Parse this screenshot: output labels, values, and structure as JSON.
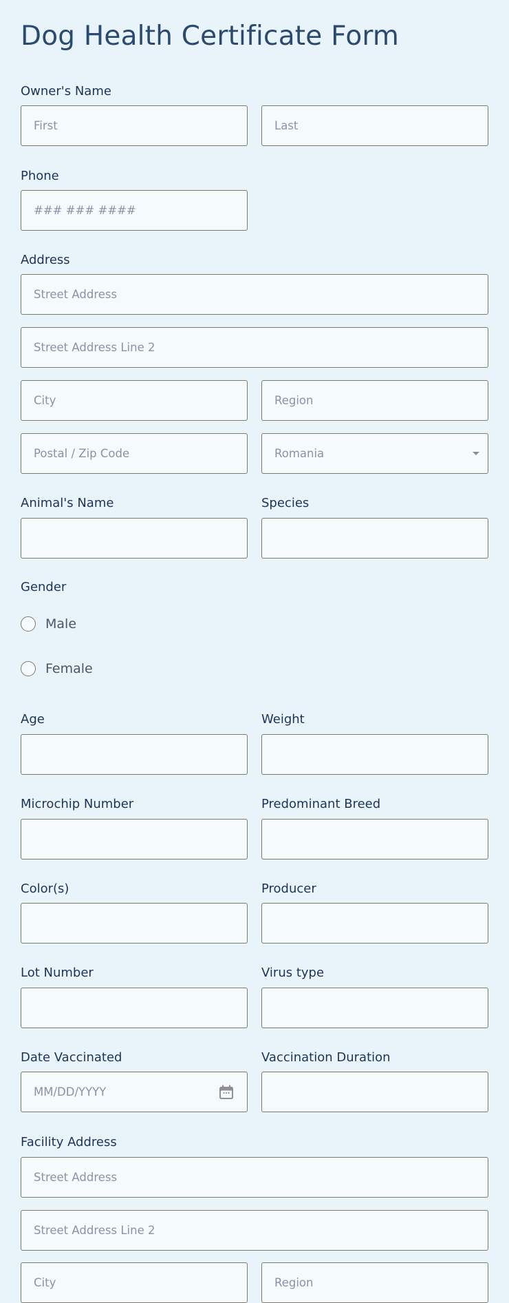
{
  "form": {
    "title": "Dog Health Certificate Form",
    "owner": {
      "label": "Owner's Name",
      "first_placeholder": "First",
      "last_placeholder": "Last"
    },
    "phone": {
      "label": "Phone",
      "placeholder": "### ### ####"
    },
    "address": {
      "label": "Address",
      "street_placeholder": "Street Address",
      "street2_placeholder": "Street Address Line 2",
      "city_placeholder": "City",
      "region_placeholder": "Region",
      "postal_placeholder": "Postal / Zip Code",
      "country_value": "Romania"
    },
    "animal_name": {
      "label": "Animal's Name",
      "value": ""
    },
    "species": {
      "label": "Species",
      "value": ""
    },
    "gender": {
      "label": "Gender",
      "options": [
        "Male",
        "Female"
      ],
      "selected": null
    },
    "age": {
      "label": "Age",
      "value": ""
    },
    "weight": {
      "label": "Weight",
      "value": ""
    },
    "microchip": {
      "label": "Microchip Number",
      "value": ""
    },
    "breed": {
      "label": "Predominant Breed",
      "value": ""
    },
    "colors": {
      "label": "Color(s)",
      "value": ""
    },
    "producer": {
      "label": "Producer",
      "value": ""
    },
    "lot_number": {
      "label": "Lot Number",
      "value": ""
    },
    "virus_type": {
      "label": "Virus type",
      "value": ""
    },
    "date_vaccinated": {
      "label": "Date Vaccinated",
      "placeholder": "MM/DD/YYYY",
      "icon": "calendar-icon"
    },
    "vaccination_duration": {
      "label": "Vaccination Duration",
      "value": ""
    },
    "facility_address": {
      "label": "Facility Address",
      "street_placeholder": "Street Address",
      "street2_placeholder": "Street Address Line 2",
      "city_placeholder": "City",
      "region_placeholder": "Region"
    }
  },
  "colors": {
    "background": "#e9f4fa",
    "input_background": "#f5fafd",
    "input_border": "#7d7a68",
    "label_text": "#1f3357",
    "placeholder_text": "#8a93a6"
  }
}
